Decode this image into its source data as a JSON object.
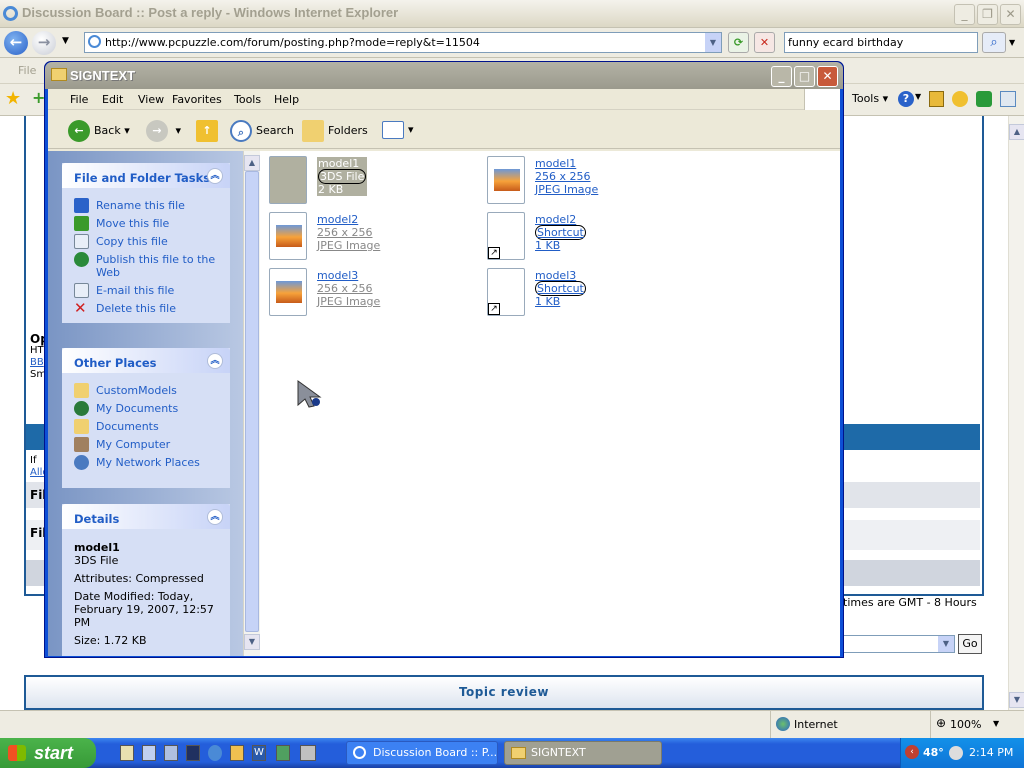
{
  "ie": {
    "title": "Discussion Board :: Post a reply - Windows Internet Explorer",
    "address": "http://www.pcpuzzle.com/forum/posting.php?mode=reply&t=11504",
    "search_value": "funny ecard birthday",
    "menu_file": "File",
    "tools_label": "Tools",
    "forum": {
      "op_label": "Op",
      "ht_label": "HT",
      "bb_label": "BB",
      "sm_label": "Sm",
      "if_label": "If",
      "allo_label": "Allo",
      "fil1_label": "Fil",
      "fil2_label": "Fil",
      "timezone_text": "times are GMT - 8 Hours",
      "go_label": "Go",
      "topic_review": "Topic review"
    },
    "status_zone": "Internet",
    "zoom": "100%"
  },
  "explorer": {
    "title": "SIGNTEXT",
    "menu": [
      "File",
      "Edit",
      "View",
      "Favorites",
      "Tools",
      "Help"
    ],
    "toolbar": {
      "back": "Back",
      "search": "Search",
      "folders": "Folders"
    },
    "tasks": {
      "header": "File and Folder Tasks",
      "items": [
        "Rename this file",
        "Move this file",
        "Copy this file",
        "Publish this file to the Web",
        "E-mail this file",
        "Delete this file"
      ]
    },
    "places": {
      "header": "Other Places",
      "items": [
        "CustomModels",
        "My Documents",
        "Documents",
        "My Computer",
        "My Network Places"
      ]
    },
    "details": {
      "header": "Details",
      "name": "model1",
      "type": "3DS File",
      "attributes": "Attributes: Compressed",
      "modified": "Date Modified: Today, February 19, 2007, 12:57 PM",
      "size": "Size: 1.72 KB"
    },
    "files": [
      {
        "name": "model1",
        "line2": "3DS File",
        "line3": "2 KB"
      },
      {
        "name": "model1",
        "line2": "256 x 256",
        "line3": "JPEG Image"
      },
      {
        "name": "model2",
        "line2": "256 x 256",
        "line3": "JPEG Image"
      },
      {
        "name": "model2",
        "line2": "Shortcut",
        "line3": "1 KB"
      },
      {
        "name": "model3",
        "line2": "256 x 256",
        "line3": "JPEG Image"
      },
      {
        "name": "model3",
        "line2": "Shortcut",
        "line3": "1 KB"
      }
    ]
  },
  "taskbar": {
    "start": "start",
    "tasks": [
      "Discussion Board :: P...",
      "SIGNTEXT"
    ],
    "temp": "48°",
    "clock": "2:14 PM"
  }
}
